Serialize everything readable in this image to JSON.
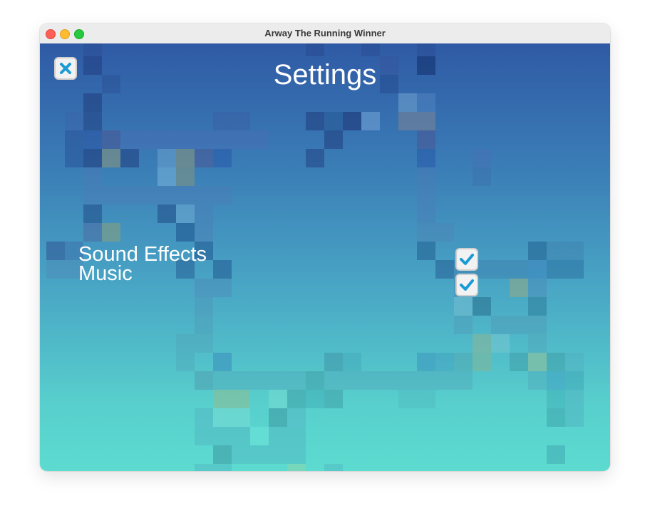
{
  "window": {
    "title": "Arway The Running Winner"
  },
  "settings": {
    "title": "Settings",
    "close_icon": "close-x-icon",
    "options": [
      {
        "label": "Sound Effects",
        "checked": true,
        "icon": "checkmark-icon"
      },
      {
        "label": "Music",
        "checked": true,
        "icon": "checkmark-icon"
      }
    ]
  },
  "colors": {
    "background_top": "#2f5aa5",
    "background_bottom": "#5cdbd0",
    "accent": "#1a9ad6",
    "button_fill": "#f2f2f2"
  }
}
